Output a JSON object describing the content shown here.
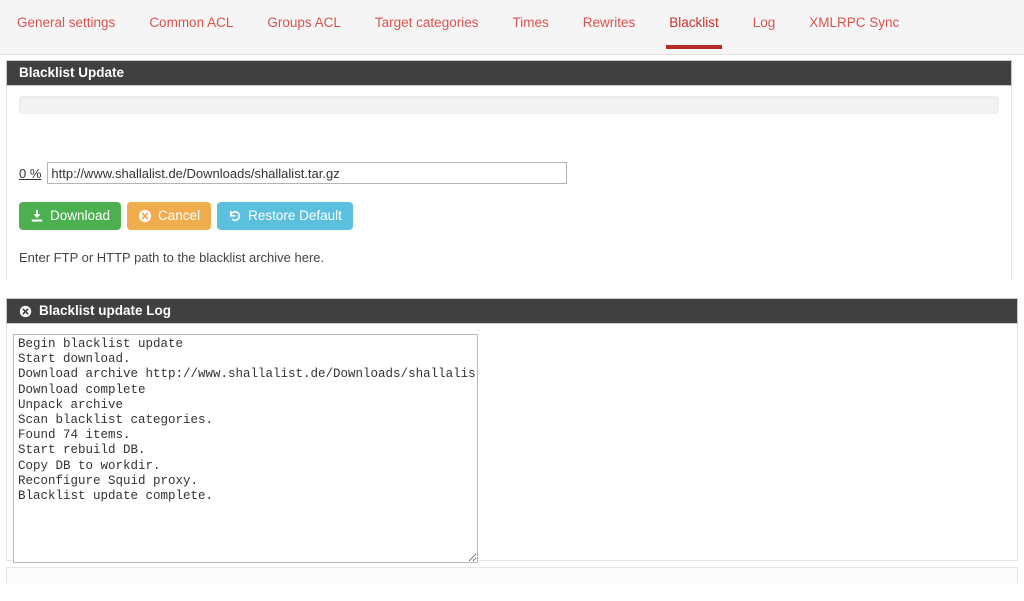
{
  "nav": {
    "tabs": [
      {
        "label": "General settings",
        "active": false
      },
      {
        "label": "Common ACL",
        "active": false
      },
      {
        "label": "Groups ACL",
        "active": false
      },
      {
        "label": "Target categories",
        "active": false
      },
      {
        "label": "Times",
        "active": false
      },
      {
        "label": "Rewrites",
        "active": false
      },
      {
        "label": "Blacklist",
        "active": true
      },
      {
        "label": "Log",
        "active": false
      },
      {
        "label": "XMLRPC Sync",
        "active": false
      }
    ],
    "active_tab": "Blacklist",
    "link_color": "#d9534f",
    "active_underline_color": "#b52b27"
  },
  "update_panel": {
    "title": "Blacklist Update",
    "header_bg": "#404040",
    "progress": {
      "percent_label": "0 %",
      "percent_value": 0,
      "track_color": "#f2f2f2"
    },
    "url_field": {
      "value": "http://www.shallalist.de/Downloads/shallalist.tar.gz",
      "placeholder": "http://"
    },
    "buttons": [
      {
        "label": "Download",
        "icon": "download-icon",
        "color": "#4caf50"
      },
      {
        "label": "Cancel",
        "icon": "circle-x-icon",
        "color": "#f0ad4e"
      },
      {
        "label": "Restore Default",
        "icon": "undo-icon",
        "color": "#5bc0de"
      }
    ],
    "help_text": "Enter FTP or HTTP path to the blacklist archive here."
  },
  "log_panel": {
    "title": "Blacklist update Log",
    "title_icon": "circle-x-icon",
    "header_bg": "#404040",
    "log_lines": [
      "Begin blacklist update",
      "Start download.",
      "Download archive http://www.shallalist.de/Downloads/shallalist.tar.gz",
      "Download complete",
      "Unpack archive",
      "Scan blacklist categories.",
      "Found 74 items.",
      "Start rebuild DB.",
      "Copy DB to workdir.",
      "Reconfigure Squid proxy.",
      "Blacklist update complete."
    ],
    "log_text": "Begin blacklist update\nStart download.\nDownload archive http://www.shallalist.de/Downloads/shallalist.tar.gz\nDownload complete\nUnpack archive\nScan blacklist categories.\nFound 74 items.\nStart rebuild DB.\nCopy DB to workdir.\nReconfigure Squid proxy.\nBlacklist update complete."
  }
}
